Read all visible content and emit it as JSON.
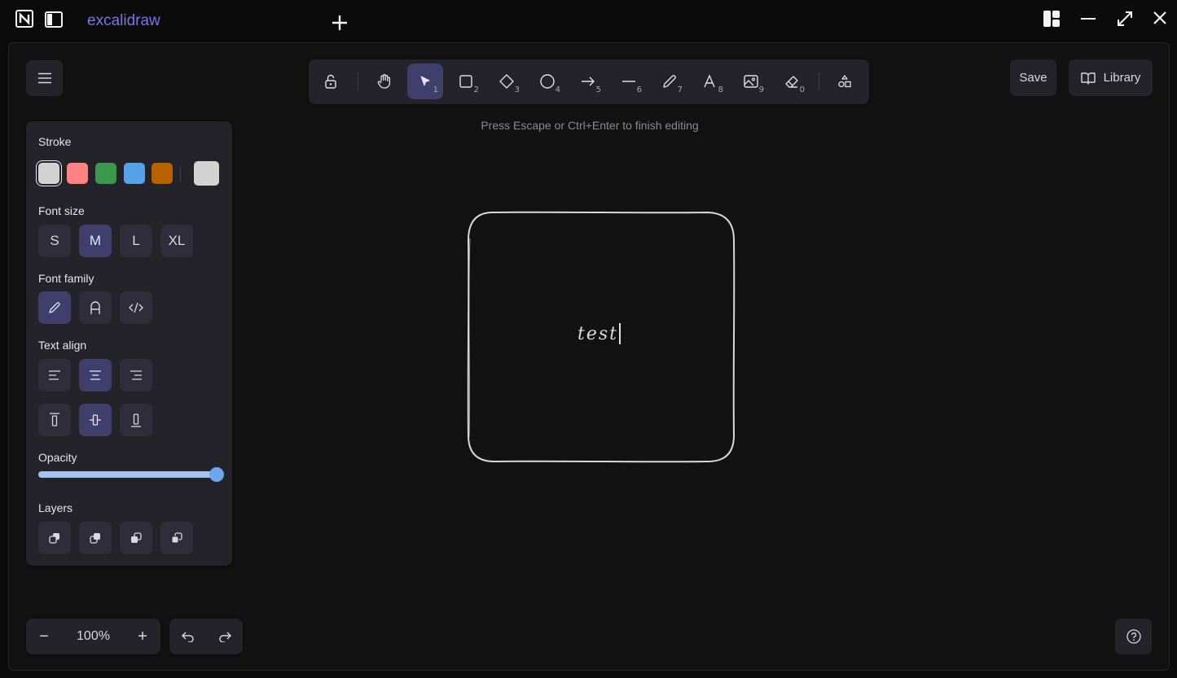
{
  "titlebar": {
    "tab_title": "excalidraw",
    "icons": [
      "notion-logo-icon",
      "sidebar-toggle-icon",
      "new-tab-plus-icon",
      "layout-grid-icon",
      "minimize-icon",
      "maximize-icon",
      "close-icon"
    ]
  },
  "toolbar": {
    "tools": [
      {
        "name": "lock-icon",
        "key": ""
      },
      {
        "name": "hand-icon",
        "key": ""
      },
      {
        "name": "selection-arrow-icon",
        "key": "1",
        "active": true
      },
      {
        "name": "rectangle-icon",
        "key": "2"
      },
      {
        "name": "diamond-icon",
        "key": "3"
      },
      {
        "name": "ellipse-icon",
        "key": "4"
      },
      {
        "name": "arrow-icon",
        "key": "5"
      },
      {
        "name": "line-icon",
        "key": "6"
      },
      {
        "name": "pencil-icon",
        "key": "7"
      },
      {
        "name": "text-icon",
        "key": "8"
      },
      {
        "name": "image-icon",
        "key": "9"
      },
      {
        "name": "eraser-icon",
        "key": "0"
      },
      {
        "name": "shapes-library-icon",
        "key": ""
      }
    ],
    "key1": "1",
    "key2": "2",
    "key3": "3",
    "key4": "4",
    "key5": "5",
    "key6": "6",
    "key7": "7",
    "key8": "8",
    "key9": "9",
    "key0": "0"
  },
  "header": {
    "save_label": "Save",
    "library_label": "Library"
  },
  "hint": "Press Escape or Ctrl+Enter to finish editing",
  "properties": {
    "stroke_label": "Stroke",
    "stroke_colors": [
      "#d3d3d3",
      "#ff8383",
      "#3a994c",
      "#56a2e8",
      "#b76100"
    ],
    "current_stroke": "#d3d3d3",
    "font_size_label": "Font size",
    "font_sizes": [
      "S",
      "M",
      "L",
      "XL"
    ],
    "font_size_selected": "M",
    "font_family_label": "Font family",
    "text_align_label": "Text align",
    "opacity_label": "Opacity",
    "opacity_value": 100,
    "layers_label": "Layers"
  },
  "canvas": {
    "text": "test"
  },
  "footer": {
    "zoom_out": "−",
    "zoom_level": "100%",
    "zoom_in": "+"
  },
  "colors": {
    "accent": "#7b75e8",
    "active_button": "#403e6a",
    "island": "#232329"
  }
}
